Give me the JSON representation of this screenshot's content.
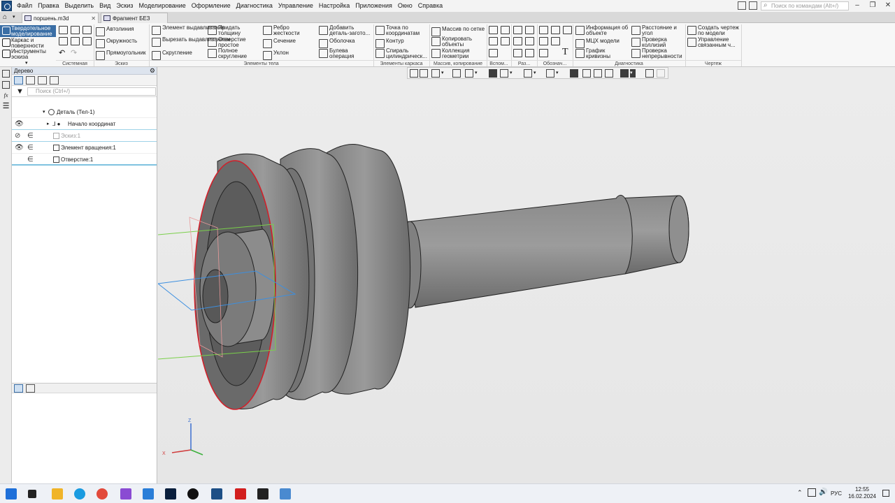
{
  "menu": [
    "Файл",
    "Правка",
    "Выделить",
    "Вид",
    "Эскиз",
    "Моделирование",
    "Оформление",
    "Диагностика",
    "Управление",
    "Настройка",
    "Приложения",
    "Окно",
    "Справка"
  ],
  "search_commands_placeholder": "Поиск по командам (Alt+/)",
  "tabs": [
    "поршень.m3d",
    "Фрагмент БЕЗ ИМЕ..."
  ],
  "modes": [
    "Твердотельное моделирование",
    "Каркас и поверхности",
    "Инструменты эскиза"
  ],
  "ribbon": {
    "sketch": [
      "Автолиния",
      "Окружность",
      "Прямоугольник"
    ],
    "body_col1": [
      "Элемент выдавливания",
      "Вырезать выдавливанием",
      "Скругление"
    ],
    "body_col2": [
      "Придать толщину",
      "Отверстие простое",
      "Полное скругление"
    ],
    "body_col3": [
      "Ребро жесткости",
      "Сечение",
      "Уклон"
    ],
    "body_col4": [
      "Добавить деталь-загото...",
      "Оболочка",
      "Булева операция"
    ],
    "frame": [
      "Точка по координатам",
      "Контур",
      "Спираль цилиндрическ..."
    ],
    "array": [
      "Массив по сетке",
      "Копировать объекты",
      "Коллекция геометрии"
    ],
    "diag_col1": [
      "Информация об объекте",
      "МЦХ модели",
      "График кривизны"
    ],
    "diag_col2": [
      "Расстояние и угол",
      "Проверка коллизий",
      "Проверка непрерывности"
    ],
    "drawing": [
      "Создать чертеж по модели",
      "Управление связанным ч..."
    ],
    "groups": [
      "Системная",
      "Эскиз",
      "Элементы тела",
      "Элементы каркаса",
      "Массив, копирование",
      "Вспом...",
      "Раз...",
      "Обознач...",
      "Диагностика",
      "Чертеж"
    ]
  },
  "tree": {
    "title": "Дерево",
    "search_placeholder": "Поиск (Ctrl+/)",
    "items": [
      "Деталь (Тел-1)",
      "Начало координат",
      "Эскиз:1",
      "Элемент вращения:1",
      "Отверстие:1"
    ]
  },
  "axis": {
    "z": "Z",
    "x": "X"
  },
  "clock": {
    "time": "12:55",
    "date": "16.02.2024"
  },
  "lang": "РУС",
  "colors": {
    "accent": "#3a6ea5",
    "edge_highlight": "#d0202a",
    "part": "#8c8c8c"
  }
}
